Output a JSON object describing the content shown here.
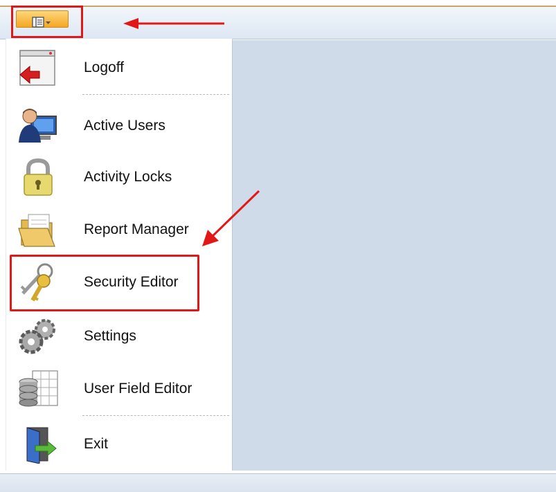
{
  "toolbar": {
    "app_button_icon": "application-menu-icon",
    "dropdown_icon": "chevron-down-icon"
  },
  "menu": {
    "items": [
      {
        "label": "Logoff",
        "icon": "logoff-icon"
      },
      {
        "label": "Active Users",
        "icon": "active-users-icon"
      },
      {
        "label": "Activity Locks",
        "icon": "padlock-icon"
      },
      {
        "label": "Report Manager",
        "icon": "folder-icon"
      },
      {
        "label": "Security Editor",
        "icon": "keys-icon"
      },
      {
        "label": "Settings",
        "icon": "gears-icon"
      },
      {
        "label": "User Field Editor",
        "icon": "database-table-icon"
      },
      {
        "label": "Exit",
        "icon": "exit-door-icon"
      }
    ]
  },
  "annotations": {
    "highlight_color": "#e01818"
  },
  "colors": {
    "app_button": "#f5a623",
    "content_background": "#d0dbea",
    "toolbar": "#dde7f3"
  }
}
